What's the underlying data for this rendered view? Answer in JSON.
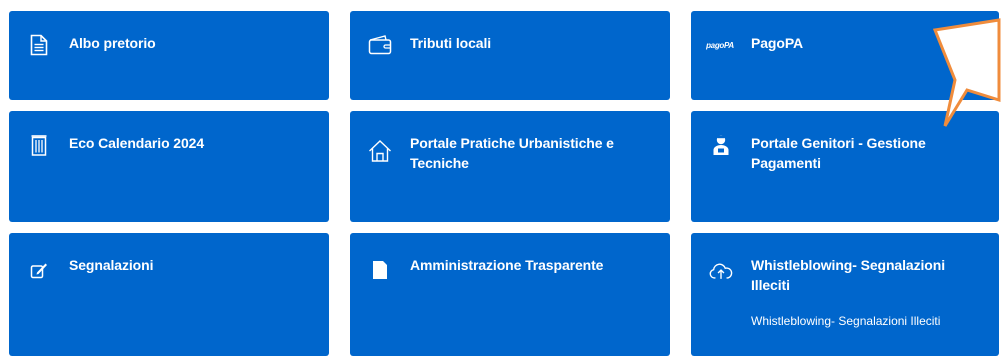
{
  "tiles": [
    {
      "title": "Albo pretorio",
      "icon": "document-icon"
    },
    {
      "title": "Tributi locali",
      "icon": "wallet-icon"
    },
    {
      "title": "PagoPA",
      "icon": "pagopa-logo-icon",
      "logo_text": "pagoPA"
    },
    {
      "title": "Eco Calendario 2024",
      "icon": "trash-bin-icon"
    },
    {
      "title": "Portale Pratiche Urbanistiche e Tecniche",
      "icon": "home-icon"
    },
    {
      "title": "Portale Genitori - Gestione Pagamenti",
      "icon": "parent-user-icon"
    },
    {
      "title": "Segnalazioni",
      "icon": "edit-icon"
    },
    {
      "title": "Amministrazione Trasparente",
      "icon": "file-icon"
    },
    {
      "title": "Whistleblowing- Segnalazioni Illeciti",
      "icon": "cloud-icon",
      "description": "Whistleblowing- Segnalazioni Illeciti"
    }
  ],
  "colors": {
    "tile_bg": "#0066cc",
    "text": "#ffffff",
    "callout_fill": "#ffffff",
    "callout_stroke": "#f08c3c"
  }
}
